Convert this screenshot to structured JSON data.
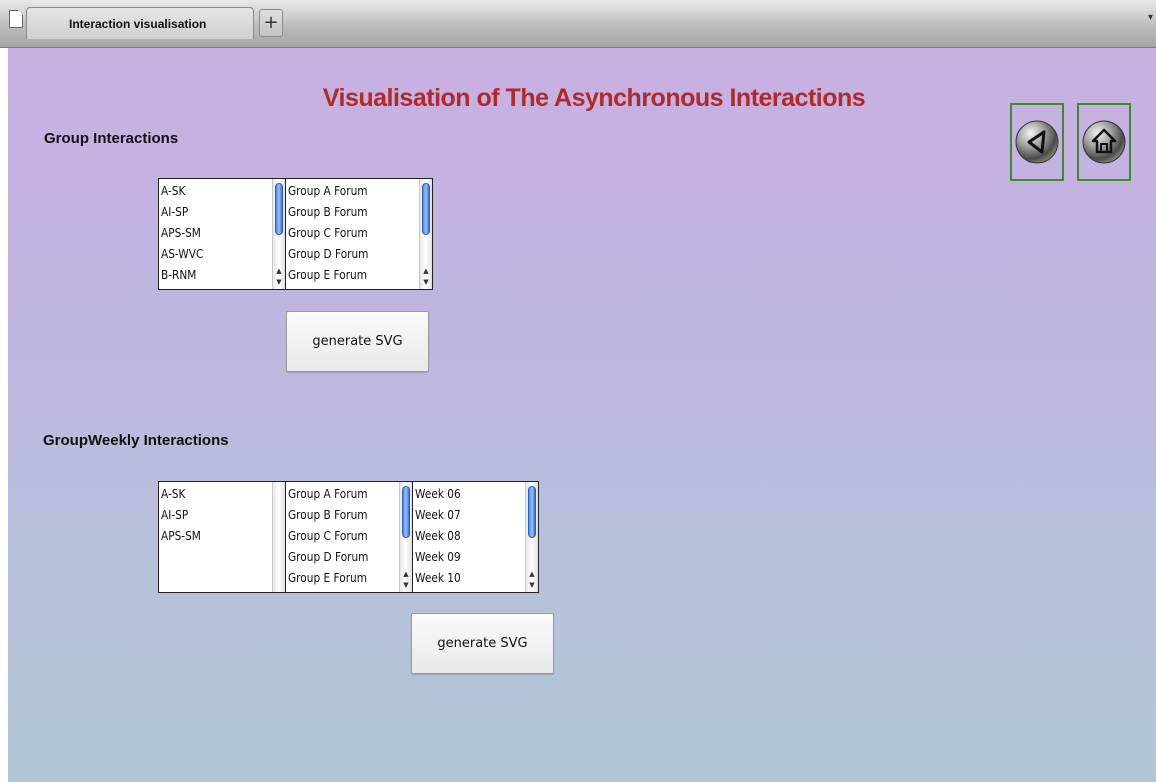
{
  "browser": {
    "tab_title": "Interaction visualisation",
    "new_tab_label": "+"
  },
  "page": {
    "title": "Visualisation of The Asynchronous Interactions"
  },
  "section1": {
    "heading": "Group Interactions",
    "groups": [
      "A-SK",
      "AI-SP",
      "APS-SM",
      "AS-WVC",
      "B-RNM"
    ],
    "forums": [
      "Group A Forum",
      "Group B Forum",
      "Group C Forum",
      "Group D Forum",
      "Group E Forum"
    ],
    "button_label": "generate SVG"
  },
  "section2": {
    "heading": "GroupWeekly Interactions",
    "groups": [
      "A-SK",
      "AI-SP",
      "APS-SM"
    ],
    "forums": [
      "Group A Forum",
      "Group B Forum",
      "Group C Forum",
      "Group D Forum",
      "Group E Forum"
    ],
    "weeks": [
      "Week 06",
      "Week 07",
      "Week 08",
      "Week 09",
      "Week 10"
    ],
    "button_label": "generate SVG"
  },
  "nav": {
    "back_icon": "back-arrow-icon",
    "home_icon": "home-icon",
    "frame_color": "#3e8a2f"
  },
  "colors": {
    "title": "#b02a2a",
    "background_top": "#c9b0e2",
    "background_bottom": "#b2c7d6"
  }
}
